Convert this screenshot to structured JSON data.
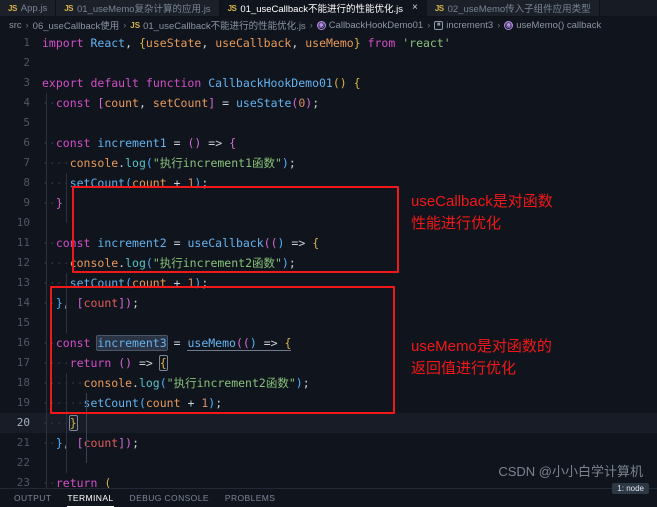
{
  "tabs": [
    {
      "label": "App.js",
      "icon": "js-file-icon",
      "active": false,
      "closable": false
    },
    {
      "label": "01_useMemo复杂计算的应用.js",
      "icon": "js-file-icon",
      "active": false,
      "closable": false
    },
    {
      "label": "01_useCallback不能进行的性能优化.js",
      "icon": "js-file-icon",
      "active": true,
      "closable": true,
      "close_label": "×"
    },
    {
      "label": "02_useMemo传入子组件应用类型",
      "icon": "js-file-icon",
      "active": false,
      "closable": false
    }
  ],
  "breadcrumb": {
    "separator": "›",
    "items": [
      {
        "label": "src",
        "icon": ""
      },
      {
        "label": "06_useCallback使用",
        "icon": ""
      },
      {
        "label": "01_useCallback不能进行的性能优化.js",
        "icon": "js-file-icon"
      },
      {
        "label": "CallbackHookDemo01",
        "icon": "function-symbol-icon"
      },
      {
        "label": "increment3",
        "icon": "variable-symbol-icon"
      },
      {
        "label": "useMemo() callback",
        "icon": "function-symbol-icon"
      }
    ]
  },
  "editor": {
    "language": "javascript",
    "current_line": 20,
    "lines": [
      {
        "n": "1",
        "text": "import React, {useState, useCallback, useMemo} from 'react'"
      },
      {
        "n": "2",
        "text": ""
      },
      {
        "n": "3",
        "text": "export default function CallbackHookDemo01() {"
      },
      {
        "n": "4",
        "text": "  const [count, setCount] = useState(0);"
      },
      {
        "n": "5",
        "text": ""
      },
      {
        "n": "6",
        "text": "  const increment1 = () => {"
      },
      {
        "n": "7",
        "text": "    console.log(\"执行increment1函数\");"
      },
      {
        "n": "8",
        "text": "    setCount(count + 1);"
      },
      {
        "n": "9",
        "text": "  }"
      },
      {
        "n": "10",
        "text": ""
      },
      {
        "n": "11",
        "text": "  const increment2 = useCallback(() => {"
      },
      {
        "n": "12",
        "text": "    console.log(\"执行increment2函数\");"
      },
      {
        "n": "13",
        "text": "    setCount(count + 1);"
      },
      {
        "n": "14",
        "text": "  }, [count]);"
      },
      {
        "n": "15",
        "text": ""
      },
      {
        "n": "16",
        "text": "  const increment3 = useMemo(() => {"
      },
      {
        "n": "17",
        "text": "    return () => {"
      },
      {
        "n": "18",
        "text": "      console.log(\"执行increment2函数\");"
      },
      {
        "n": "19",
        "text": "      setCount(count + 1);"
      },
      {
        "n": "20",
        "text": "    }"
      },
      {
        "n": "21",
        "text": "  }, [count]);"
      },
      {
        "n": "22",
        "text": ""
      },
      {
        "n": "23",
        "text": "  return ("
      }
    ]
  },
  "annotations": [
    {
      "text": "useCallback是对函数\n性能进行优化",
      "color": "#f01818"
    },
    {
      "text": "useMemo是对函数的\n返回值进行优化",
      "color": "#f01818"
    }
  ],
  "watermark": {
    "text": "CSDN @小小白学计算机"
  },
  "status": {
    "node_badge": "1: node"
  },
  "panel": {
    "tabs": [
      {
        "label": "OUTPUT",
        "active": false
      },
      {
        "label": "TERMINAL",
        "active": true
      },
      {
        "label": "DEBUG CONSOLE",
        "active": false
      },
      {
        "label": "PROBLEMS",
        "active": false
      }
    ]
  },
  "colors": {
    "editor_background": "#10141c",
    "tabbar_background": "#171b24",
    "annotation_red": "#f01818",
    "keyword": "#d44ec9",
    "string": "#88c07a",
    "identifier": "#63b3f0",
    "variable": "#e89a5a"
  }
}
